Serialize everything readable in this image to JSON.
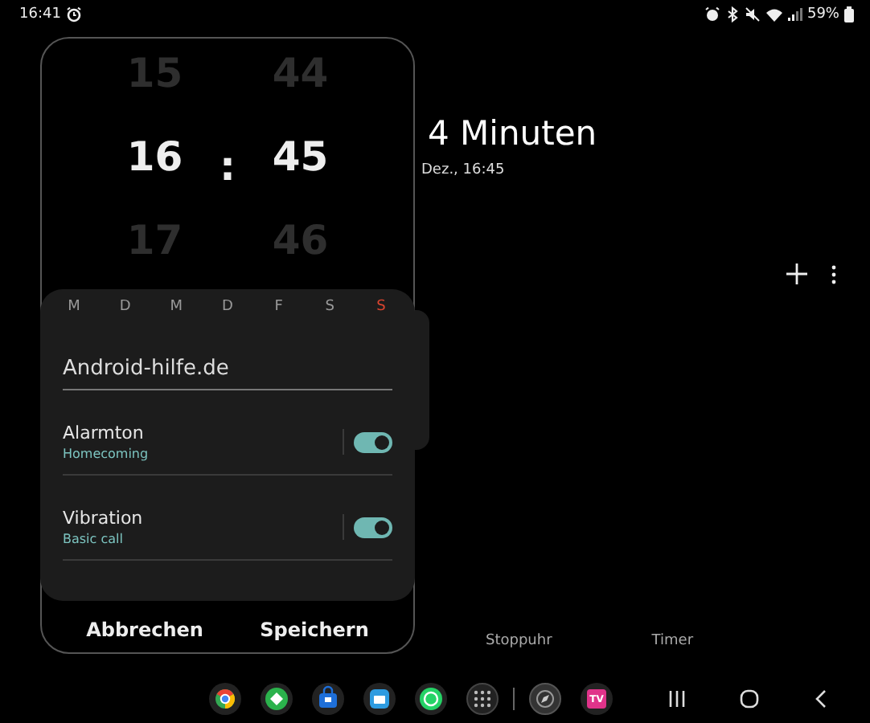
{
  "status_bar": {
    "time": "16:41",
    "battery": "59%"
  },
  "background": {
    "headline": "4 Minuten",
    "subline": "Dez., 16:45",
    "tabs": [
      {
        "label": "Stoppuhr"
      },
      {
        "label": "Timer"
      }
    ]
  },
  "alarm_editor": {
    "picker": {
      "hours": [
        "15",
        "16",
        "17"
      ],
      "minutes": [
        "44",
        "45",
        "46"
      ],
      "separator": ":"
    },
    "weekdays": [
      {
        "label": "M",
        "color": "#9a9a9a"
      },
      {
        "label": "D",
        "color": "#9a9a9a"
      },
      {
        "label": "M",
        "color": "#9a9a9a"
      },
      {
        "label": "D",
        "color": "#9a9a9a"
      },
      {
        "label": "F",
        "color": "#9a9a9a"
      },
      {
        "label": "S",
        "color": "#9a9a9a"
      },
      {
        "label": "S",
        "color": "#d9442f"
      }
    ],
    "name": {
      "value": "Android-hilfe.de"
    },
    "settings": [
      {
        "label": "Alarmton",
        "value": "Homecoming",
        "on": true
      },
      {
        "label": "Vibration",
        "value": "Basic call",
        "on": true
      }
    ],
    "buttons": [
      "Abbrechen",
      "Speichern"
    ]
  },
  "taskbar": {
    "apps": [
      {
        "kind": "chrome"
      },
      {
        "kind": "green"
      },
      {
        "kind": "bag"
      },
      {
        "kind": "folder"
      },
      {
        "kind": "whatsapp"
      },
      {
        "kind": "grid"
      },
      {
        "kind": "compass"
      },
      {
        "kind": "tv",
        "label": "TV"
      }
    ],
    "nav": [
      {
        "kind": "recent"
      },
      {
        "kind": "home"
      },
      {
        "kind": "back"
      }
    ]
  }
}
